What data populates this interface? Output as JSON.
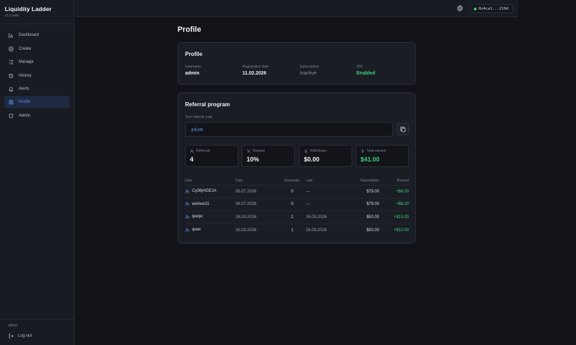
{
  "app": {
    "title": "Liquidity Ladder",
    "version": "v1.0 web"
  },
  "sidebar": {
    "items": [
      {
        "label": "Dashboard",
        "icon": "chart-icon"
      },
      {
        "label": "Create",
        "icon": "plus-circle-icon"
      },
      {
        "label": "Manage",
        "icon": "list-icon"
      },
      {
        "label": "History",
        "icon": "history-icon"
      },
      {
        "label": "Alerts",
        "icon": "bell-icon"
      },
      {
        "label": "Profile",
        "icon": "user-circle-icon",
        "active": true
      },
      {
        "label": "Admin",
        "icon": "shield-icon"
      }
    ],
    "user": "admin",
    "logout_label": "Log out"
  },
  "topbar": {
    "wallet": "0x4ca1...219d",
    "wallet_status_color": "#3ed17d"
  },
  "page": {
    "title": "Profile"
  },
  "profile": {
    "title": "Profile",
    "username_label": "Username",
    "username": "admin",
    "registration_label": "Registration date",
    "registration": "11.02.2026",
    "subscription_label": "Subscription",
    "subscription": "Inactive",
    "twofa_label": "2FA",
    "twofa": "Enabled"
  },
  "referral": {
    "title": "Referral program",
    "code_label": "Your referral code",
    "code": "pkom",
    "stats": [
      {
        "label": "Referrals",
        "value": "4",
        "icon": "users-icon"
      },
      {
        "label": "Reward",
        "value": "10%",
        "icon": "percent-icon"
      },
      {
        "label": "Withdrawn",
        "value": "$0.00",
        "icon": "dollar-icon"
      },
      {
        "label": "Total earned",
        "value": "$41.00",
        "icon": "dollar-icon"
      }
    ],
    "columns": [
      "User",
      "Date",
      "Renewals",
      "Last",
      "Subscription",
      "Reward"
    ],
    "rows": [
      {
        "user": "Cy36jHGEJA",
        "date": "06.07.2026",
        "renewals": "0",
        "last": "—",
        "subscription": "$79.00",
        "reward": "+$8.00"
      },
      {
        "user": "wehwe31",
        "date": "06.07.2026",
        "renewals": "0",
        "last": "—",
        "subscription": "$79.00",
        "reward": "+$8.00"
      },
      {
        "user": "qwqw",
        "date": "26.03.2026",
        "renewals": "2",
        "last": "26.03.2026",
        "subscription": "$50.00",
        "reward": "+$15.00"
      },
      {
        "user": "qwer",
        "date": "26.03.2026",
        "renewals": "1",
        "last": "26.03.2026",
        "subscription": "$50.00",
        "reward": "+$10.00"
      }
    ]
  },
  "colors": {
    "accent": "#5b8fe8",
    "success": "#3ed17d",
    "background": "#111318"
  }
}
